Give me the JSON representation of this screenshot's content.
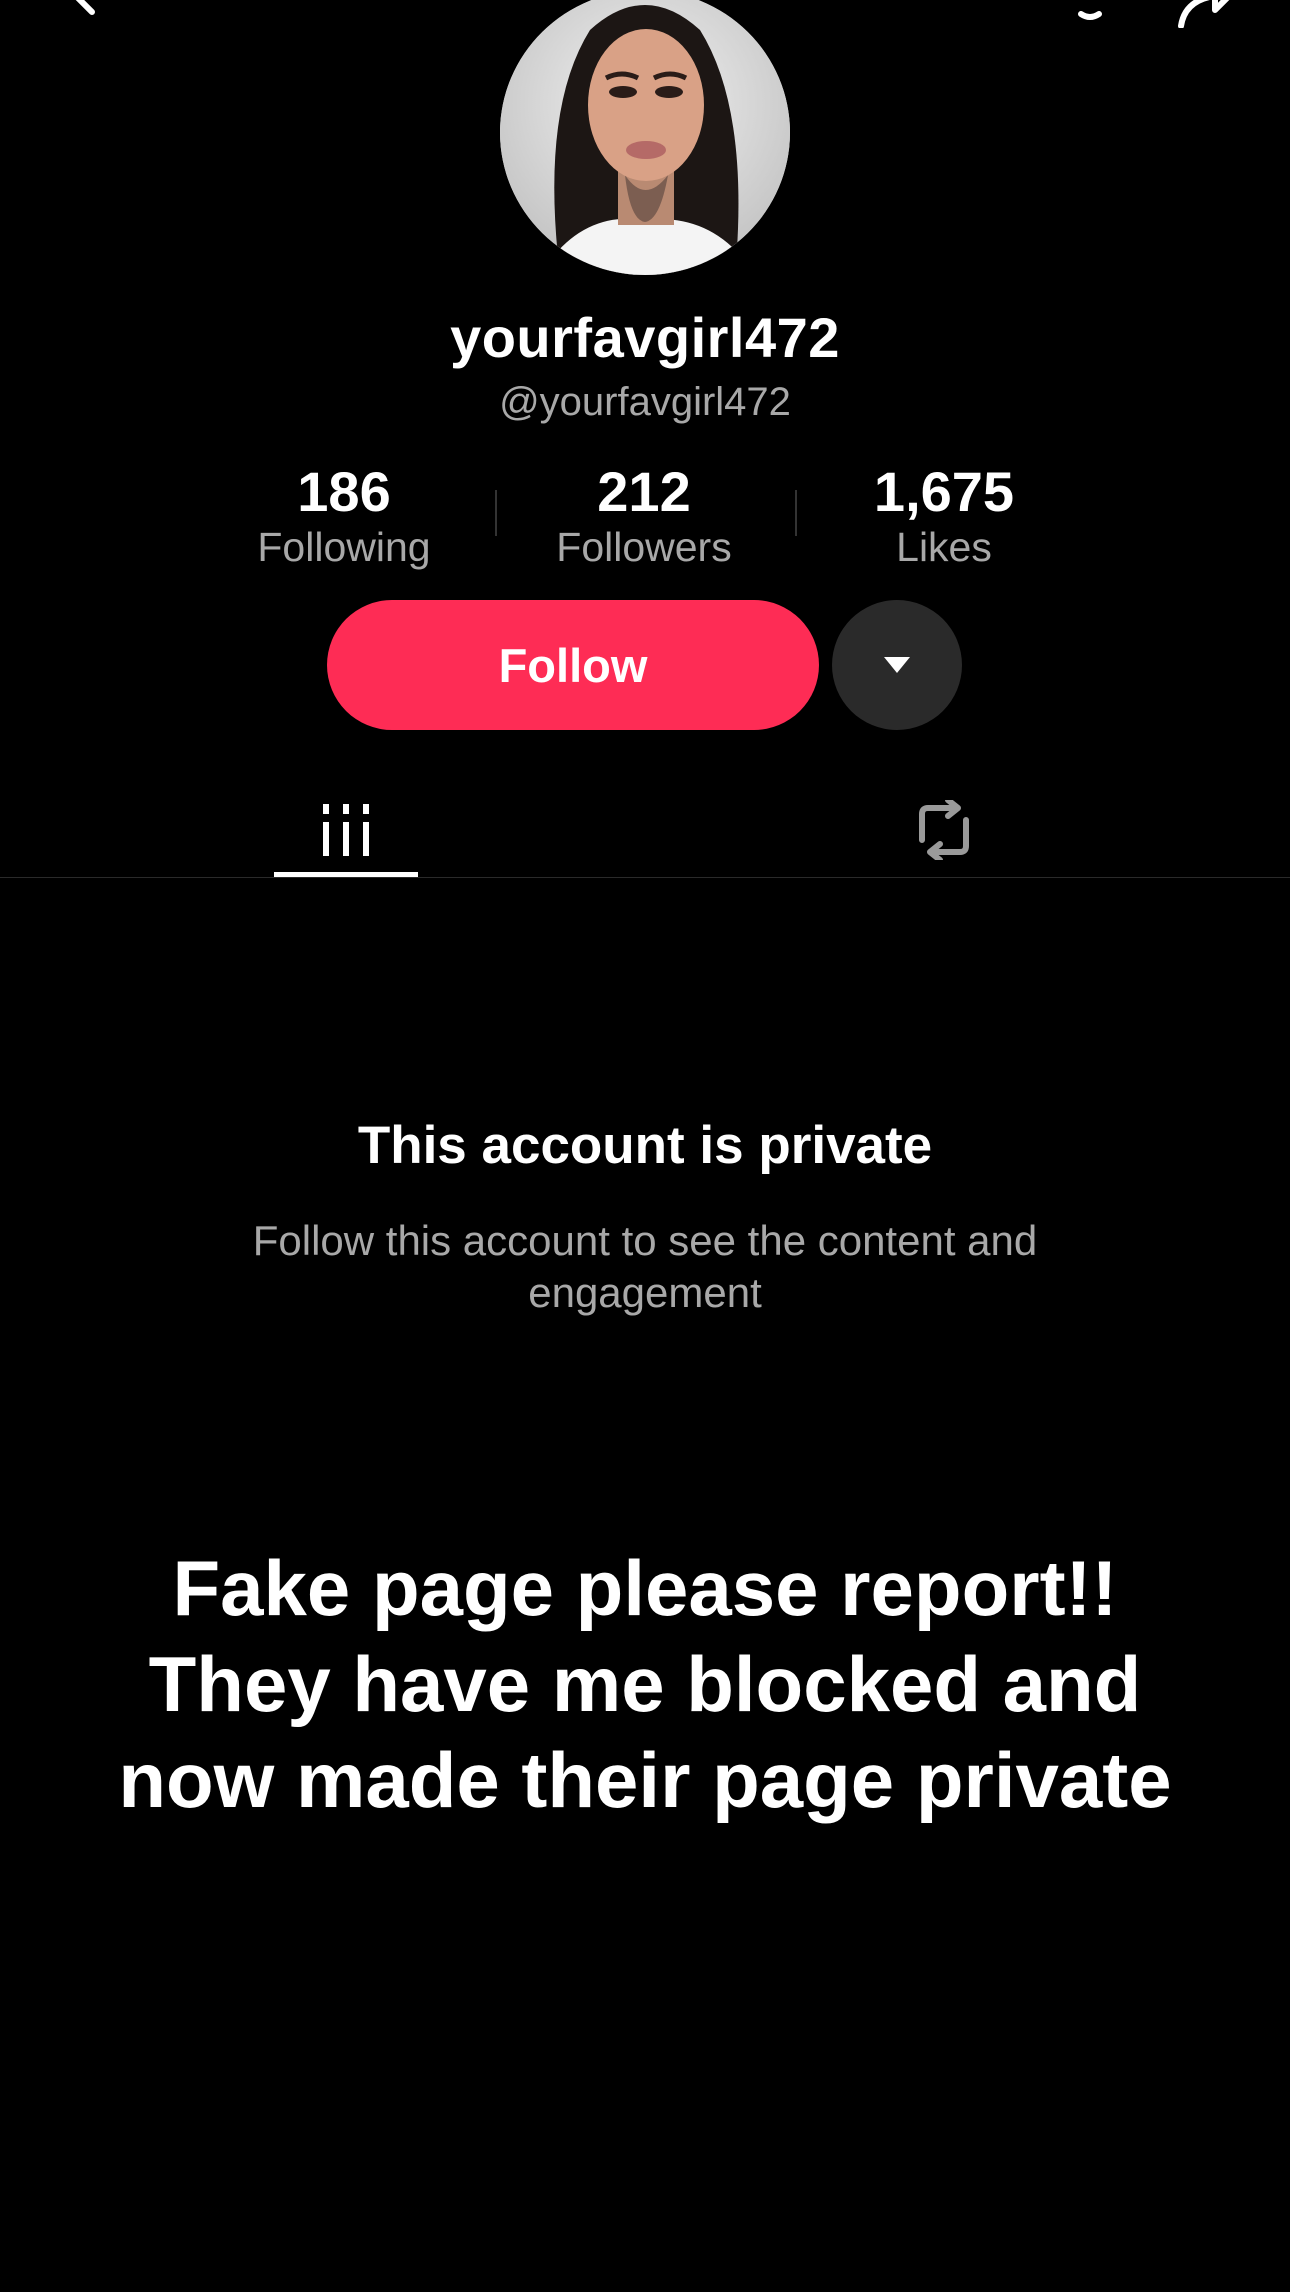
{
  "profile": {
    "display_name": "yourfavgirl472",
    "handle": "@yourfavgirl472"
  },
  "stats": [
    {
      "value": "186",
      "label": "Following"
    },
    {
      "value": "212",
      "label": "Followers"
    },
    {
      "value": "1,675",
      "label": "Likes"
    }
  ],
  "actions": {
    "follow_label": "Follow"
  },
  "icons": {
    "back": "chevron-left-icon",
    "notifications": "bell-icon",
    "share": "share-arrow-icon",
    "more": "caret-down-icon",
    "videos_tab": "grid-icon",
    "reposts_tab": "repost-icon"
  },
  "private_notice": {
    "title": "This account is private",
    "subtitle": "Follow this account to see the content and engagement"
  },
  "caption": {
    "line1": "Fake page please report!!",
    "line2": "They have me blocked and",
    "line3": "now made their page private"
  },
  "colors": {
    "background": "#000000",
    "accent": "#fe2c55",
    "secondary_text": "#a8a8a8"
  }
}
